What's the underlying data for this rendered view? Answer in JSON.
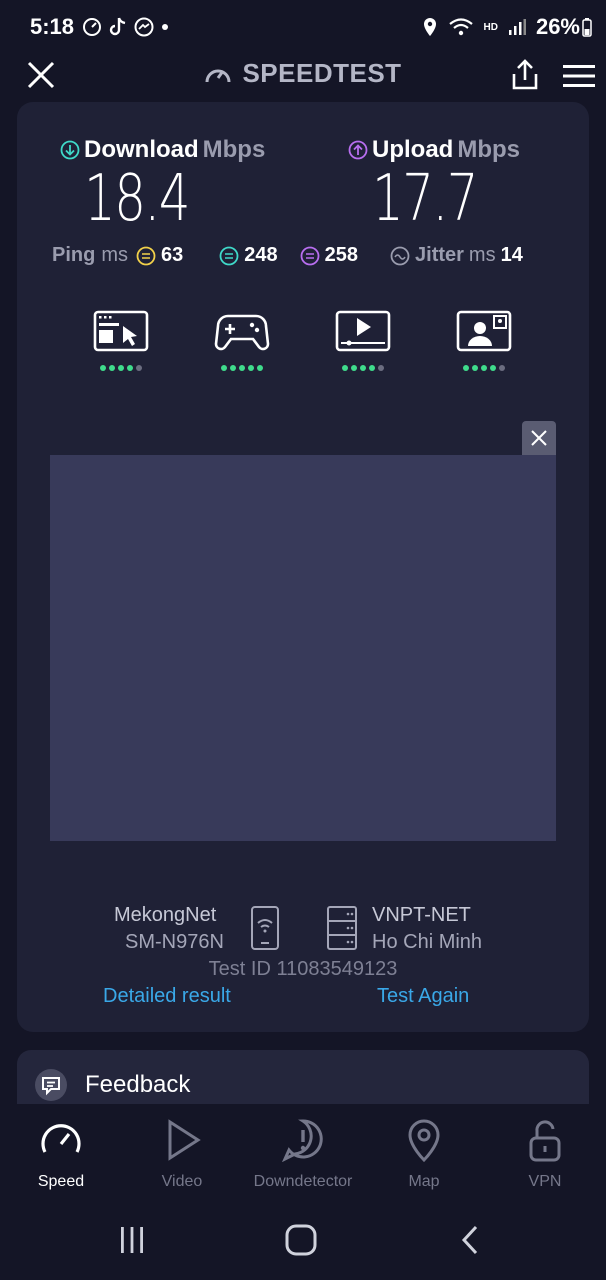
{
  "status": {
    "time": "5:18",
    "battery": "26%"
  },
  "header": {
    "title": "SPEEDTEST"
  },
  "result": {
    "download": {
      "label": "Download",
      "unit": "Mbps",
      "value": "18.4"
    },
    "upload": {
      "label": "Upload",
      "unit": "Mbps",
      "value": "17.7"
    },
    "ping": {
      "label": "Ping",
      "unit": "ms",
      "idle": "63",
      "download": "248",
      "upload": "258"
    },
    "jitter": {
      "label": "Jitter",
      "unit": "ms",
      "value": "14"
    }
  },
  "quality": [
    {
      "icon": "web-browsing-icon",
      "rating": 4,
      "max": 5
    },
    {
      "icon": "gaming-icon",
      "rating": 5,
      "max": 5
    },
    {
      "icon": "video-streaming-icon",
      "rating": 4,
      "max": 5
    },
    {
      "icon": "video-call-icon",
      "rating": 4,
      "max": 5
    }
  ],
  "connection": {
    "provider": "MekongNet",
    "device": "SM-N976N",
    "server": "VNPT-NET",
    "location": "Ho Chi Minh",
    "test_id": "Test ID 11083549123"
  },
  "actions": {
    "detailed": "Detailed result",
    "again": "Test Again"
  },
  "feedback": {
    "label": "Feedback"
  },
  "nav": [
    {
      "label": "Speed",
      "icon": "speed-gauge-icon",
      "active": true
    },
    {
      "label": "Video",
      "icon": "play-icon",
      "active": false
    },
    {
      "label": "Downdetector",
      "icon": "alert-icon",
      "active": false
    },
    {
      "label": "Map",
      "icon": "map-pin-icon",
      "active": false
    },
    {
      "label": "VPN",
      "icon": "lock-icon",
      "active": false
    }
  ],
  "colors": {
    "background": "#141526",
    "card": "#1f2136",
    "download_accent": "#3fd9c9",
    "upload_accent": "#b86ef0",
    "link": "#3aa8e8",
    "good": "#3fdc8c"
  }
}
